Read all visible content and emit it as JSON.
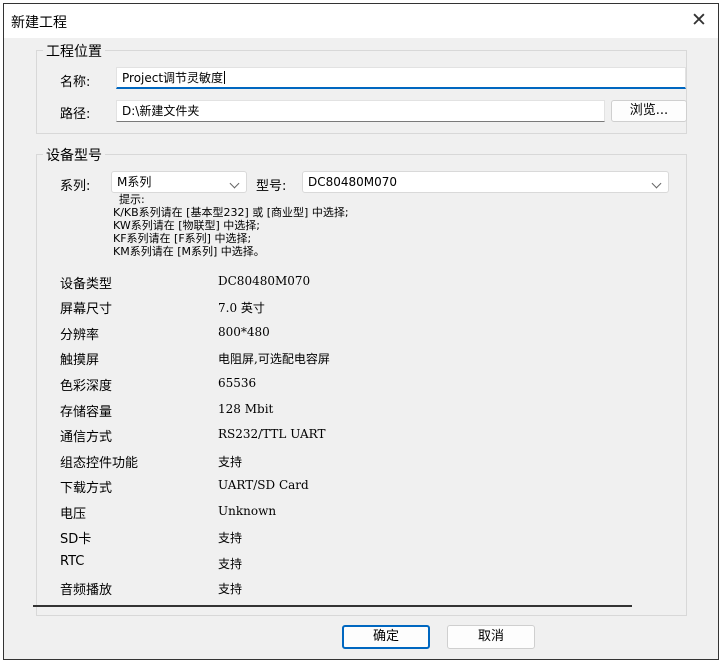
{
  "window": {
    "title": "新建工程"
  },
  "location_group": {
    "legend": "工程位置",
    "name_label": "名称:",
    "name_value": "Project调节灵敏度",
    "path_label": "路径:",
    "path_value": "D:\\新建文件夹",
    "browse_label": "浏览..."
  },
  "device_group": {
    "legend": "设备型号",
    "series_label": "系列:",
    "series_value": "M系列",
    "model_label": "型号:",
    "model_value": "DC80480M070",
    "hints": {
      "title": "提示:",
      "lines": [
        "K/KB系列请在 [基本型232] 或 [商业型] 中选择;",
        "KW系列请在 [物联型] 中选择;",
        "KF系列请在 [F系列] 中选择;",
        "KM系列请在 [M系列] 中选择。"
      ]
    },
    "specs": [
      {
        "name": "设备类型",
        "value": "DC80480M070"
      },
      {
        "name": "屏幕尺寸",
        "value": "7.0 英寸"
      },
      {
        "name": "分辨率",
        "value": "800*480"
      },
      {
        "name": "触摸屏",
        "value": "电阻屏,可选配电容屏"
      },
      {
        "name": "色彩深度",
        "value": "65536"
      },
      {
        "name": "存储容量",
        "value": "128 Mbit"
      },
      {
        "name": "通信方式",
        "value": "RS232/TTL UART"
      },
      {
        "name": "组态控件功能",
        "value": "支持"
      },
      {
        "name": "下载方式",
        "value": "UART/SD Card"
      },
      {
        "name": "电压",
        "value": "Unknown"
      },
      {
        "name": "SD卡",
        "value": "支持"
      },
      {
        "name": "RTC",
        "value": "支持"
      },
      {
        "name": "音频播放",
        "value": "支持"
      }
    ]
  },
  "footer": {
    "ok_label": "确定",
    "cancel_label": "取消"
  },
  "colors": {
    "accent": "#0067c0",
    "dialog_bg": "#f0f0f0",
    "field_bg": "#ffffff"
  }
}
